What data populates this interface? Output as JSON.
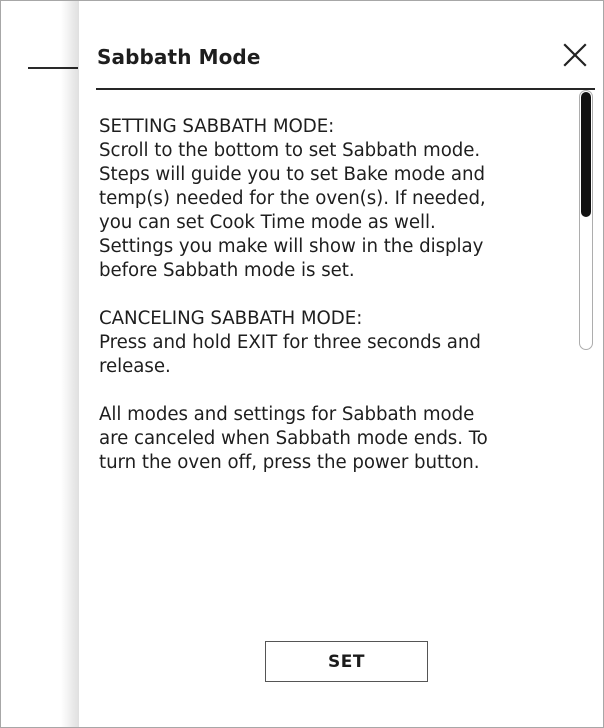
{
  "dialog": {
    "title": "Sabbath Mode",
    "close_icon": "close-icon",
    "sections": {
      "setting": {
        "heading": "SETTING SABBATH MODE:",
        "lines": [
          "Scroll to the bottom to set Sabbath mode.",
          "Steps will guide you to set Bake mode and",
          "temp(s) needed for the oven(s). If needed,",
          "you can set Cook Time mode as well.",
          "Settings you make will show in the display",
          "before Sabbath mode is set."
        ]
      },
      "canceling": {
        "heading": "CANCELING SABBATH MODE:",
        "lines": [
          "Press and hold EXIT for three seconds and",
          "release."
        ]
      },
      "ending": {
        "lines": [
          "All modes and settings for Sabbath mode",
          "are canceled when Sabbath mode ends. To",
          "turn the oven off, press the power button."
        ]
      }
    },
    "scrollbar": {
      "position_fraction": 0
    },
    "set_button_label": "SET"
  },
  "colors": {
    "background": "#ffffff",
    "text": "#1e1e1e",
    "divider": "#262626",
    "scroll_thumb": "#111111",
    "button_border": "#555555"
  }
}
